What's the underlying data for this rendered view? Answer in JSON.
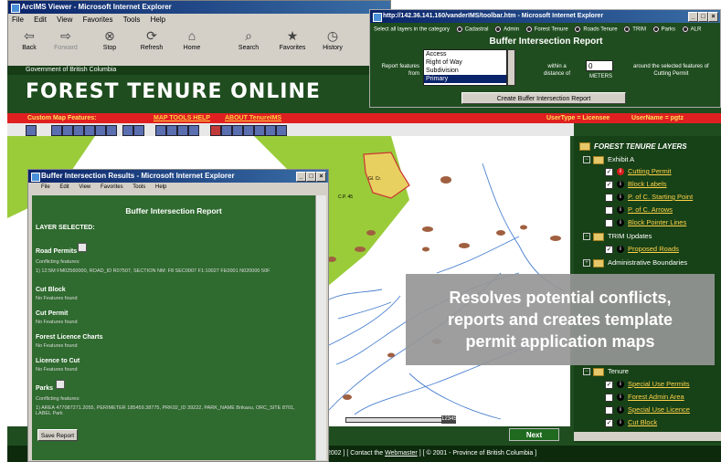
{
  "browser": {
    "title": "ArcIMS Viewer - Microsoft Internet Explorer",
    "menu": [
      "File",
      "Edit",
      "View",
      "Favorites",
      "Tools",
      "Help"
    ],
    "toolbar": [
      {
        "label": "Back",
        "icon": "back-arrow-icon"
      },
      {
        "label": "Forward",
        "icon": "forward-arrow-icon"
      },
      {
        "label": "Stop",
        "icon": "stop-icon"
      },
      {
        "label": "Refresh",
        "icon": "refresh-icon"
      },
      {
        "label": "Home",
        "icon": "home-icon"
      },
      {
        "label": "Search",
        "icon": "search-icon"
      },
      {
        "label": "Favorites",
        "icon": "favorites-icon"
      },
      {
        "label": "History",
        "icon": "history-icon"
      }
    ]
  },
  "app": {
    "gov_label": "Government of British Columbia",
    "title": "FOREST TENURE ONLINE",
    "custom_map_features": "Custom Map Features:",
    "map_tools_help": "MAP TOOLS HELP",
    "about_link": "ABOUT TenureIMS",
    "user_type": "UserType = Licensee",
    "user_name": "UserName = pgtz",
    "next_label": "Next",
    "footer_left": "2002 ] [ Contact the",
    "footer_webmaster": "Webmaster",
    "footer_right": "] [ © 2001 - Province of British Columbia ]"
  },
  "callout": {
    "line1": "Resolves potential conflicts,",
    "line2": "reports and creates template",
    "line3": "permit application maps"
  },
  "layers": {
    "header": "FOREST TENURE LAYERS",
    "group_exhibit": "Exhibit A",
    "items_exhibit": [
      "Cutting Permit",
      "Block Labels",
      "P. of C. Starting Point",
      "P. of C. Arrows",
      "Block Pointer Lines"
    ],
    "group_trim": "TRIM Updates",
    "items_trim": [
      "Proposed Roads"
    ],
    "group_admin": "Administrative Boundaries",
    "group_tenure": "Tenure",
    "items_tenure": [
      "Special Use Permits",
      "Forest Admin Area",
      "Special Use Licence",
      "Cut Block"
    ]
  },
  "popup_top": {
    "title": "http://142.36.141.160/vanderIMS/toolbar.htm - Microsoft Internet Explorer",
    "select_label": "Select all layers in the category",
    "categories": [
      "Cadastral",
      "Admin",
      "Forest Tenure",
      "Roads Tenure",
      "TRIM",
      "Parks",
      "ALR"
    ],
    "heading": "Buffer Intersection Report",
    "report_label_1": "Report features",
    "report_label_2": "from",
    "list_items": [
      "Access",
      "Right of Way",
      "Subdivision",
      "Primary"
    ],
    "within_1": "within a",
    "within_2": "distance of",
    "distance_value": "0",
    "unit": "METERS",
    "around_1": "around the selected features of",
    "around_2": "Cutting Permit",
    "create_button": "Create Buffer Intersection Report"
  },
  "popup_results": {
    "title": "Buffer Intersection Results - Microsoft Internet Explorer",
    "menu": [
      "File",
      "Edit",
      "View",
      "Favorites",
      "Tools",
      "Help"
    ],
    "heading": "Buffer Intersection Report",
    "layer_selected": "LAYER SELECTED:",
    "sections": [
      {
        "name": "Road Permits",
        "sub": "Conflicting features:",
        "detail": "1) 12:5M FM02560000, ROAD_ID R07507, SECTION NM: F8 SEC0007 F1:10027 FE0001 N020000 50F"
      },
      {
        "name": "Cut Block",
        "sub": "No Features found"
      },
      {
        "name": "Cut Permit",
        "sub": "No Features found"
      },
      {
        "name": "Forest Licence Charts",
        "sub": "No Features found"
      },
      {
        "name": "Licence to Cut",
        "sub": "No Features found"
      },
      {
        "name": "Parks",
        "sub": "Conflicting features:",
        "detail": "1) AREA 477087271.2055, PERIMETER 185459.38775, PRK02_ID 39222, PARK_NAME Brikasu, ORC_SITE 8701, LABEL Park"
      }
    ],
    "save_button": "Save Report"
  },
  "map_labels": {
    "label_a": "Gl. Cr.",
    "label_b": "C.P. 45",
    "label_c": "12345"
  },
  "colors": {
    "accent_green": "#1f4d1f",
    "alert_red": "#e02020",
    "link_yellow": "#ffd24a"
  }
}
